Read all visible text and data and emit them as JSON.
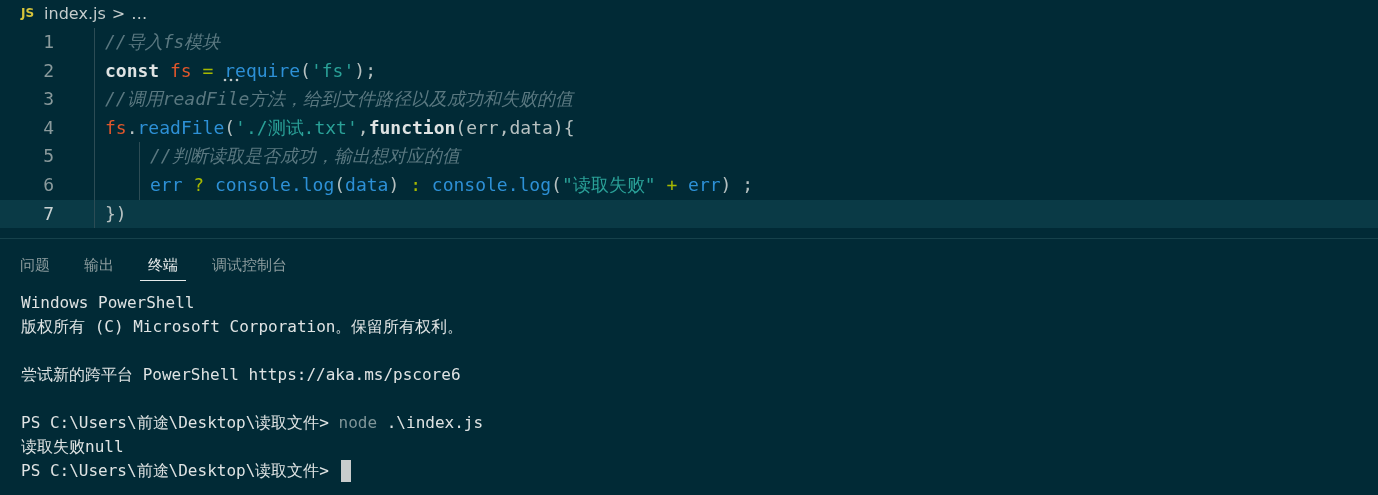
{
  "breadcrumb": {
    "file_badge": "JS",
    "file": "index.js",
    "separator": ">",
    "more": "…"
  },
  "editor": {
    "lines": [
      {
        "number": "1",
        "current": false,
        "tokens": [
          {
            "text": "//导入fs模块",
            "kind": "comment"
          }
        ]
      },
      {
        "number": "2",
        "current": false,
        "tokens": [
          {
            "text": "const ",
            "kind": "keyword"
          },
          {
            "text": "fs",
            "kind": "variable"
          },
          {
            "text": " = ",
            "kind": "operator"
          },
          {
            "text": "require",
            "kind": "function",
            "hint": true
          },
          {
            "text": "(",
            "kind": "punct"
          },
          {
            "text": "'fs'",
            "kind": "string"
          },
          {
            "text": ");",
            "kind": "punct"
          }
        ]
      },
      {
        "number": "3",
        "current": false,
        "tokens": [
          {
            "text": "//调用readFile方法，给到文件路径以及成功和失败的值",
            "kind": "comment"
          }
        ]
      },
      {
        "number": "4",
        "current": false,
        "tokens": [
          {
            "text": "fs",
            "kind": "variable"
          },
          {
            "text": ".",
            "kind": "punct"
          },
          {
            "text": "readFile",
            "kind": "function"
          },
          {
            "text": "(",
            "kind": "punct"
          },
          {
            "text": "'./测试.txt'",
            "kind": "string"
          },
          {
            "text": ",",
            "kind": "punct"
          },
          {
            "text": "function",
            "kind": "keyword"
          },
          {
            "text": "(err,data){",
            "kind": "punct"
          }
        ],
        "children": [
          {
            "number": "5",
            "current": false,
            "tokens": [
              {
                "text": "//判断读取是否成功，输出想对应的值",
                "kind": "comment"
              }
            ]
          },
          {
            "number": "6",
            "current": false,
            "tokens": [
              {
                "text": "err",
                "kind": "function"
              },
              {
                "text": " ? ",
                "kind": "operator"
              },
              {
                "text": "console.log",
                "kind": "function"
              },
              {
                "text": "(",
                "kind": "punct"
              },
              {
                "text": "data",
                "kind": "function"
              },
              {
                "text": ") ",
                "kind": "punct"
              },
              {
                "text": ": ",
                "kind": "operator"
              },
              {
                "text": "console.log",
                "kind": "function"
              },
              {
                "text": "(",
                "kind": "punct"
              },
              {
                "text": "\"读取失败\"",
                "kind": "string"
              },
              {
                "text": " + ",
                "kind": "operator"
              },
              {
                "text": "err",
                "kind": "function"
              },
              {
                "text": ") ;",
                "kind": "punct"
              }
            ]
          }
        ]
      },
      {
        "number": "7",
        "current": true,
        "tokens": [
          {
            "text": "})",
            "kind": "punct"
          }
        ]
      }
    ]
  },
  "panel": {
    "tabs": [
      {
        "label": "问题",
        "selected": false
      },
      {
        "label": "输出",
        "selected": false
      },
      {
        "label": "终端",
        "selected": true
      },
      {
        "label": "调试控制台",
        "selected": false
      }
    ],
    "terminal": [
      {
        "kind": "text",
        "segments": [
          {
            "text": "Windows PowerShell",
            "kind": "plain"
          }
        ]
      },
      {
        "kind": "text",
        "segments": [
          {
            "text": "版权所有 (C) Microsoft Corporation。保留所有权利。",
            "kind": "plain"
          }
        ]
      },
      {
        "kind": "blank"
      },
      {
        "kind": "text",
        "segments": [
          {
            "text": "尝试新的跨平台 PowerShell https://aka.ms/pscore6",
            "kind": "plain"
          }
        ]
      },
      {
        "kind": "blank"
      },
      {
        "kind": "text",
        "segments": [
          {
            "text": "PS C:\\Users\\前途\\Desktop\\读取文件> ",
            "kind": "plain"
          },
          {
            "text": "node",
            "kind": "dim"
          },
          {
            "text": " .\\index.js",
            "kind": "plain"
          }
        ]
      },
      {
        "kind": "text",
        "segments": [
          {
            "text": "读取失败null",
            "kind": "plain"
          }
        ]
      },
      {
        "kind": "text",
        "cursor": true,
        "segments": [
          {
            "text": "PS C:\\Users\\前途\\Desktop\\读取文件> ",
            "kind": "plain"
          }
        ]
      }
    ]
  }
}
